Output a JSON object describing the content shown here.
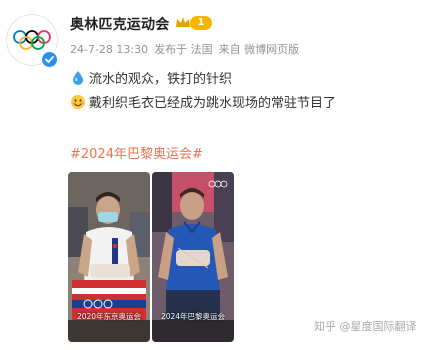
{
  "post": {
    "username": "奥林匹克运动会",
    "level": "1",
    "meta": {
      "date": "24-7-28 13:30",
      "posted_from": "发布于 法国",
      "source": "来自 微博网页版"
    },
    "line1": "流水的观众，铁打的针织",
    "line2": "戴利织毛衣已经成为跳水现场的常驻节目了",
    "hashtag": "#2024年巴黎奥运会#",
    "images": [
      {
        "caption": "2020年东京奥运会"
      },
      {
        "caption": "2024年巴黎奥运会"
      }
    ]
  },
  "watermark": "知乎 @星度国际翻译",
  "colors": {
    "hashtag": "#eb7350",
    "verified": "#2c8ff3",
    "level_badge": "#f7b500",
    "meta_text": "#939393"
  },
  "icons": [
    "olympic-rings-icon",
    "verified-icon",
    "crown-icon",
    "water-drop-icon",
    "smile-emoji-icon"
  ]
}
